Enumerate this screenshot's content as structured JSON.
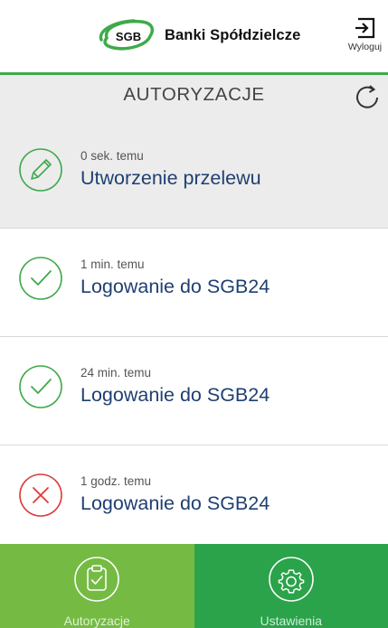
{
  "header": {
    "logo_mark_text": "SGB",
    "logo_text": "Banki Spółdzielcze",
    "logout_label": "Wyloguj"
  },
  "titlebar": {
    "title": "AUTORYZACJE",
    "refresh_icon": "refresh-icon"
  },
  "authorizations": [
    {
      "time": "0 sek. temu",
      "title": "Utworzenie przelewu",
      "status": "pending",
      "icon": "pencil-icon"
    },
    {
      "time": "1 min. temu",
      "title": "Logowanie do SGB24",
      "status": "accepted",
      "icon": "check-icon"
    },
    {
      "time": "24 min. temu",
      "title": "Logowanie do SGB24",
      "status": "accepted",
      "icon": "check-icon"
    },
    {
      "time": "1 godz. temu",
      "title": "Logowanie do SGB24",
      "status": "rejected",
      "icon": "cross-icon"
    }
  ],
  "bottom_nav": {
    "tabs": [
      {
        "label": "Autoryzacje",
        "icon": "clipboard-check-icon",
        "active": true
      },
      {
        "label": "Ustawienia",
        "icon": "gear-icon",
        "active": false
      }
    ]
  },
  "colors": {
    "brand_green": "#3faa4b",
    "accept_green": "#3faa4b",
    "reject_red": "#e03a3a",
    "title_blue": "#1f3f72",
    "tab_light_green": "#75bb43",
    "tab_dark_green": "#2aa34a"
  }
}
